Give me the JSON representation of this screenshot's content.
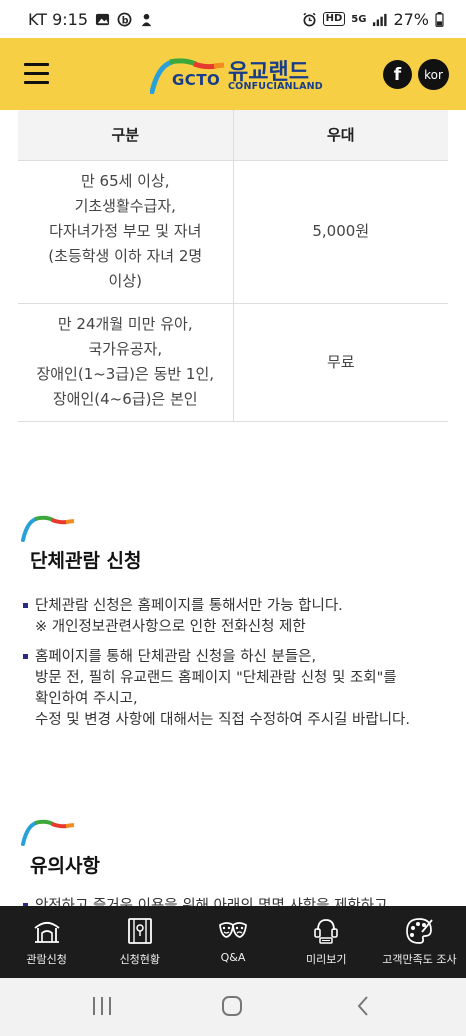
{
  "status_bar": {
    "carrier_time": "KT 9:15",
    "network": "5G",
    "battery": "27%"
  },
  "header": {
    "logo_gcto": "GCTO",
    "logo_kr": "유교랜드",
    "logo_en": "CONFUCIANLAND",
    "facebook": "f",
    "language": "kor"
  },
  "table": {
    "headers": [
      "구분",
      "우대"
    ],
    "rows": [
      {
        "condition": [
          "만 65세 이상,",
          "기초생활수급자,",
          "다자녀가정 부모 및 자녀",
          "(초등학생 이하 자녀 2명",
          "이상)"
        ],
        "benefit": "5,000원"
      },
      {
        "condition": [
          "만 24개월 미만 유아,",
          "국가유공자,",
          "장애인(1~3급)은 동반 1인,",
          "장애인(4~6급)은 본인"
        ],
        "benefit": "무료"
      }
    ]
  },
  "group_section": {
    "title": "단체관람 신청",
    "items": [
      {
        "lines": [
          "단체관람 신청은 홈페이지를 통해서만 가능 합니다.",
          "※ 개인정보관련사항으로 인한 전화신청 제한"
        ]
      },
      {
        "lines": [
          "홈페이지를 통해 단체관람 신청을 하신 분들은,",
          "방문 전, 필히 유교랜드 홈페이지 \"단체관람 신청 및 조회\"를",
          "확인하여 주시고,",
          "수정 및 변경 사항에 대해서는 직접 수정하여 주시길 바랍니다."
        ]
      }
    ]
  },
  "notice_section": {
    "title": "유의사항",
    "partial_text": "안전하고 즐거운 이용을 위해 아래의 몇몇 사항을 제한하고"
  },
  "bottom_nav": [
    {
      "label": "관람신청",
      "icon": "building-icon"
    },
    {
      "label": "신청현황",
      "icon": "map-book-icon"
    },
    {
      "label": "Q&A",
      "icon": "masks-icon"
    },
    {
      "label": "미리보기",
      "icon": "vr-headset-icon"
    },
    {
      "label": "고객만족도 조사",
      "icon": "palette-icon"
    }
  ],
  "colors": {
    "header": "#f7cf45",
    "nav": "#1c1c1c",
    "brand_blue": "#173d8a"
  }
}
